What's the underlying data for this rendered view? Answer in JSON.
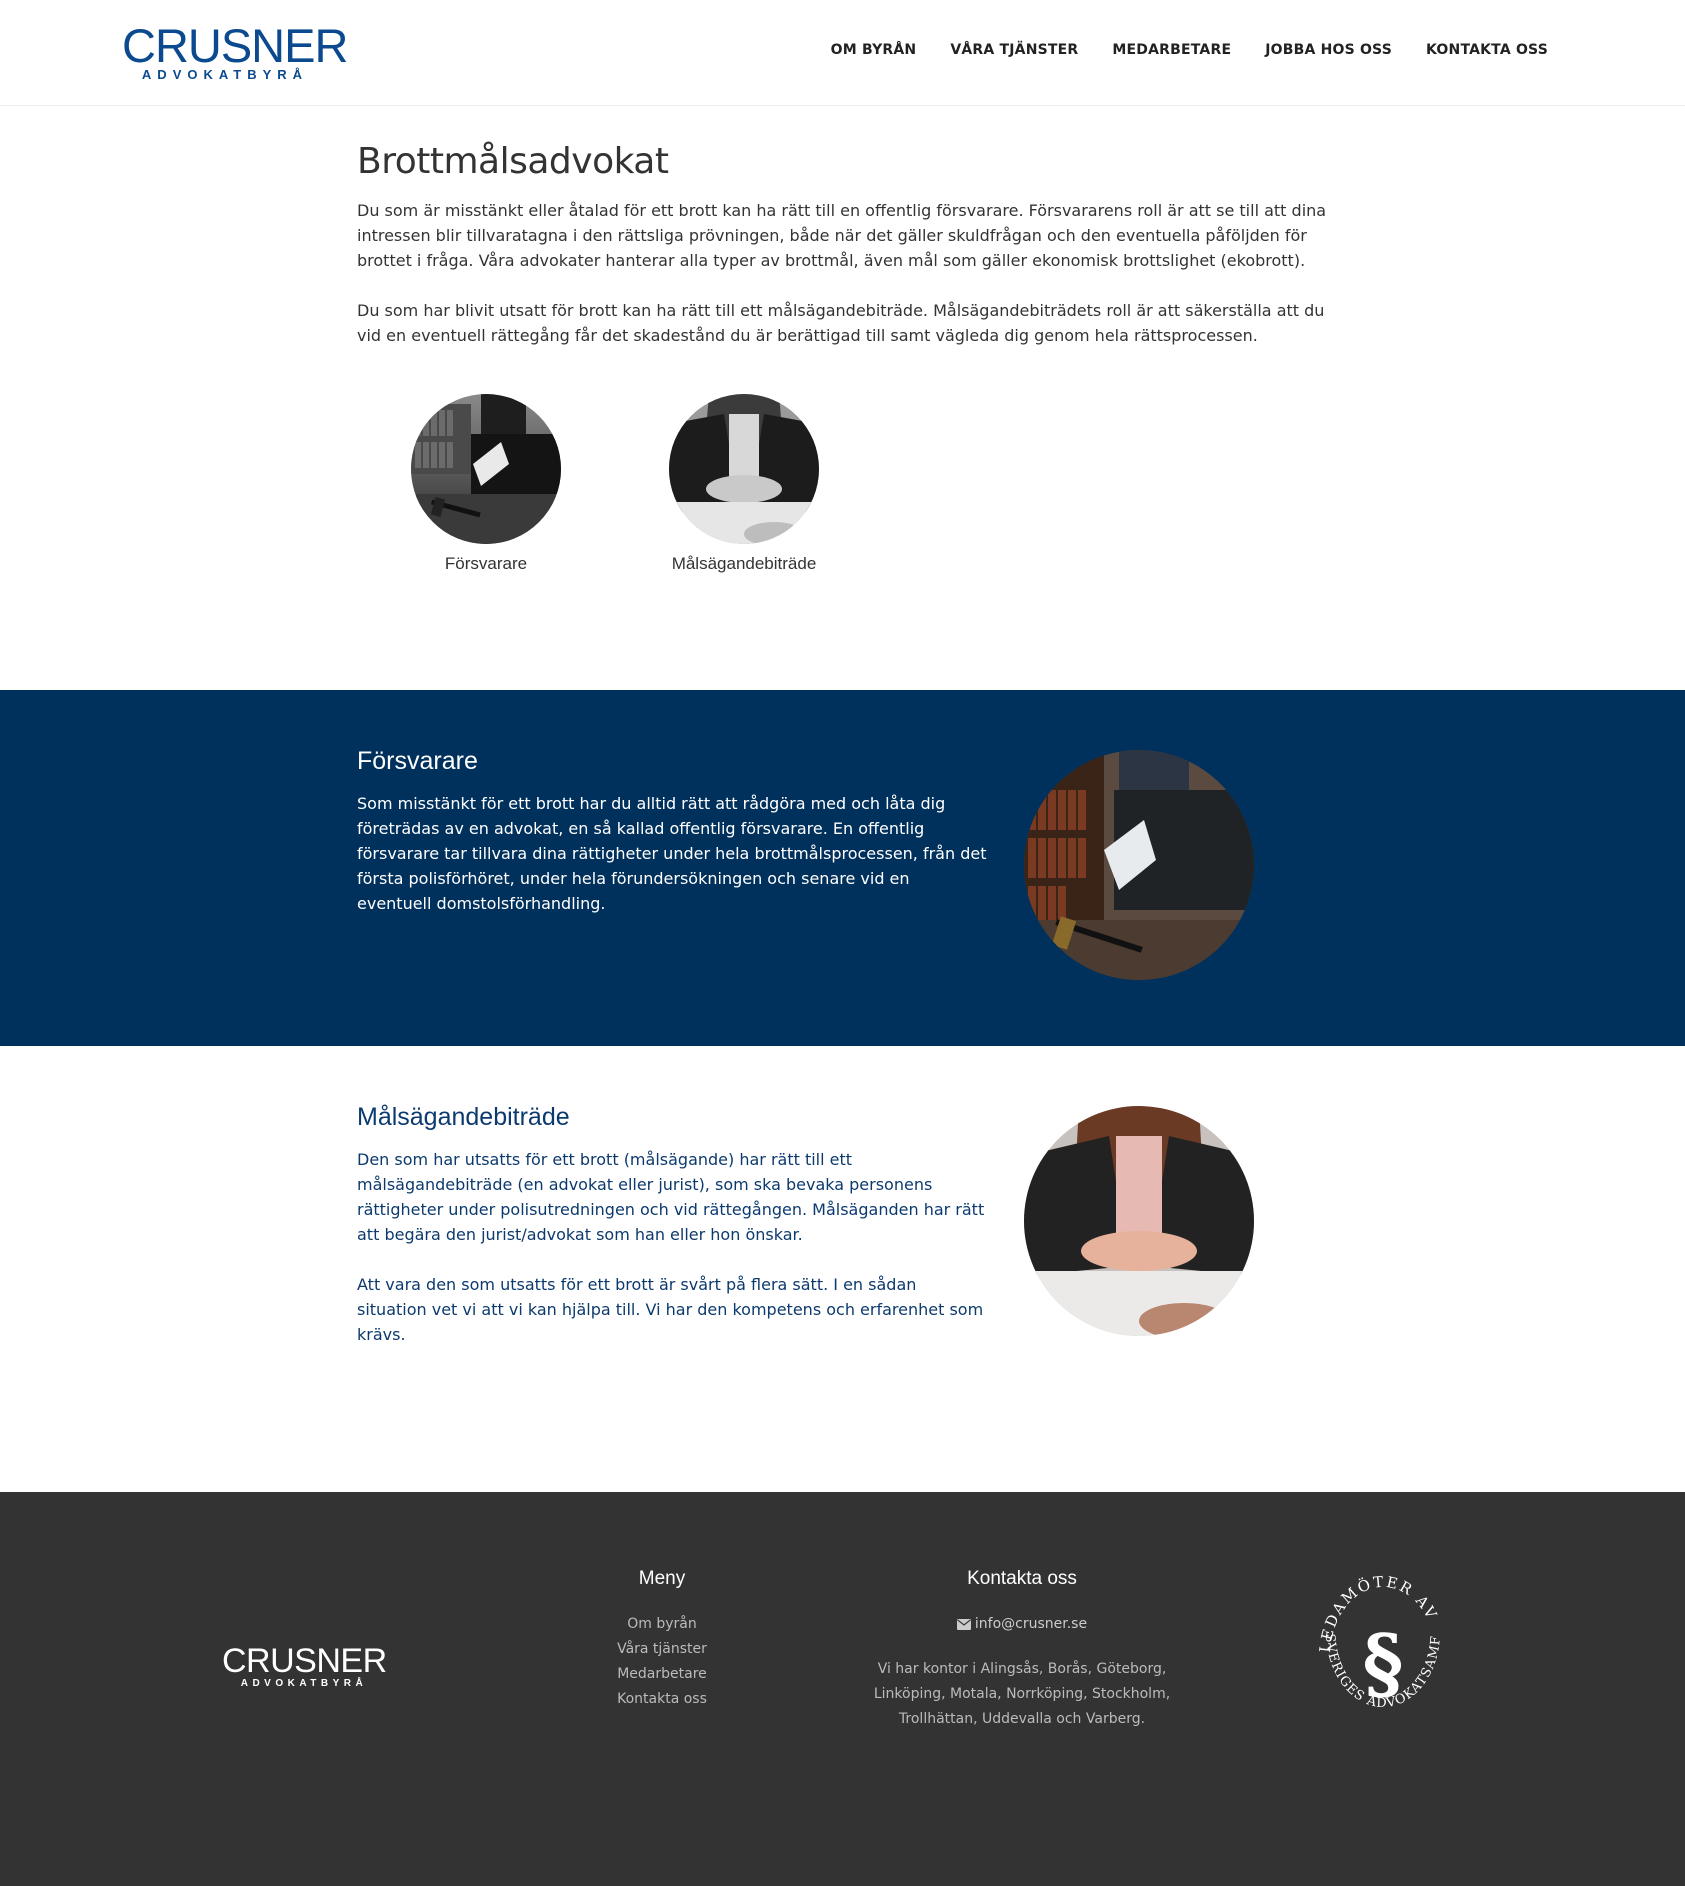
{
  "header": {
    "logo_main": "CRUSNER",
    "logo_sub": "ADVOKATBYRÅ",
    "nav": [
      "OM BYRÅN",
      "VÅRA TJÄNSTER",
      "MEDARBETARE",
      "JOBBA HOS OSS",
      "KONTAKTA OSS"
    ]
  },
  "intro": {
    "title": "Brottmålsadvokat",
    "p1": "Du som är misstänkt eller åtalad för ett brott kan ha rätt till en offentlig försvarare. Försvararens roll är att se till att dina intressen blir tillvaratagna i den rättsliga prövningen, både när det gäller skuldfrågan och den eventuella påföljden för brottet i fråga. Våra advokater hanterar alla typer av brottmål, även mål som gäller ekonomisk brottslighet (ekobrott).",
    "p2": "Du som har blivit utsatt för brott kan ha rätt till ett målsägandebiträde. Målsägandebiträdets roll är att säkerställa att du vid en eventuell rättegång får det skadestånd du är berättigad till samt vägleda dig genom hela rättsprocessen."
  },
  "services": [
    {
      "label": "Försvarare"
    },
    {
      "label": "Målsägandebiträde"
    }
  ],
  "forsvarare": {
    "title": "Försvarare",
    "p1": "Som misstänkt för ett brott har du alltid rätt att rådgöra med och låta dig företrädas av en advokat, en så kallad offentlig försvarare. En offentlig försvarare tar tillvara dina rättigheter under hela brottmålsprocessen, från det första polisförhöret, under hela förundersökningen och senare vid en eventuell domstolsförhandling."
  },
  "malsagande": {
    "title": "Målsägandebiträde",
    "p1": "Den som har utsatts för ett brott (målsägande) har rätt till ett målsägandebiträde (en advokat eller jurist), som ska bevaka personens rättigheter under polisutredningen och vid rättegången. Målsäganden har rätt att begära den jurist/advokat som han eller hon önskar.",
    "p2": "Att vara den som utsatts för ett brott är svårt på flera sätt. I en sådan situation vet vi att vi kan hjälpa till. Vi har den kompetens och erfarenhet som krävs."
  },
  "footer": {
    "logo_main": "CRUSNER",
    "logo_sub": "ADVOKATBYRÅ",
    "menu_title": "Meny",
    "menu": [
      "Om byrån",
      "Våra tjänster",
      "Medarbetare",
      "Kontakta oss"
    ],
    "contact_title": "Kontakta oss",
    "email": "info@crusner.se",
    "offices": "Vi har kontor i Alingsås, Borås, Göteborg, Linköping, Motala, Norrköping, Stockholm, Trollhättan, Uddevalla och Varberg.",
    "seal_top": "LEDAMÖTER AV",
    "seal_bottom": "SVERIGES ADVOKATSAMFUND"
  },
  "colors": {
    "brand_blue": "#0b4a8f",
    "section_blue": "#00305c",
    "footer_bg": "#333333"
  }
}
